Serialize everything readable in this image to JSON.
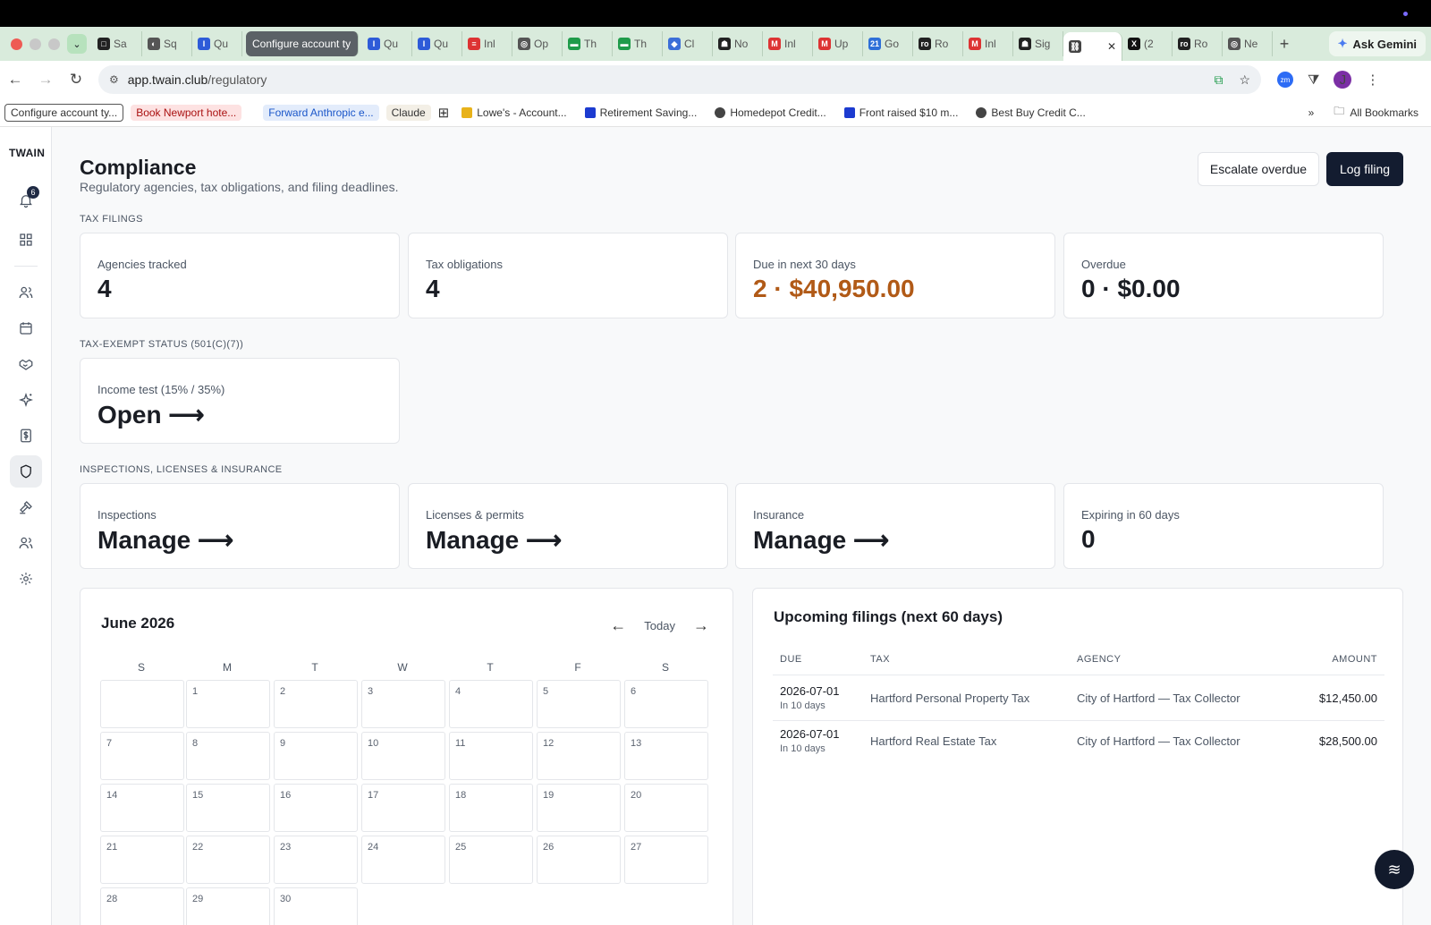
{
  "browser": {
    "tabs": [
      {
        "label": "Sa",
        "fav": "□",
        "color": "#222"
      },
      {
        "label": "Sq",
        "fav": "◐",
        "color": "#555"
      },
      {
        "label": "Qu",
        "fav": "I",
        "color": "#2e5bd8"
      },
      {
        "label": "Configure account ty",
        "highlight": true
      },
      {
        "label": "Qu",
        "fav": "I",
        "color": "#2e5bd8"
      },
      {
        "label": "Qu",
        "fav": "I",
        "color": "#2e5bd8"
      },
      {
        "label": "Inl",
        "fav": "≡",
        "color": "#d33"
      },
      {
        "label": "Op",
        "fav": "◎",
        "color": "#555"
      },
      {
        "label": "Th",
        "fav": "▬",
        "color": "#1f9b4a"
      },
      {
        "label": "Th",
        "fav": "▬",
        "color": "#1f9b4a"
      },
      {
        "label": "Cl",
        "fav": "◆",
        "color": "#3b6ed8"
      },
      {
        "label": "No",
        "fav": "☗",
        "color": "#222"
      },
      {
        "label": "Inl",
        "fav": "M",
        "color": "#d33"
      },
      {
        "label": "Up",
        "fav": "M",
        "color": "#d33"
      },
      {
        "label": "Go",
        "fav": "21",
        "color": "#2e6fd8"
      },
      {
        "label": "Ro",
        "fav": "ro",
        "color": "#222"
      },
      {
        "label": "Inl",
        "fav": "M",
        "color": "#d33"
      },
      {
        "label": "Sig",
        "fav": "☗",
        "color": "#222"
      },
      {
        "label": "",
        "fav": "⛓",
        "color": "#444",
        "active": true
      },
      {
        "label": "(2",
        "fav": "X",
        "color": "#111"
      },
      {
        "label": "Ro",
        "fav": "ro",
        "color": "#222"
      },
      {
        "label": "Ne",
        "fav": "◎",
        "color": "#555"
      }
    ],
    "gemini_label": "Ask Gemini",
    "url_host": "app.twain.club",
    "url_path": "/regulatory",
    "bookmarks": [
      {
        "label": "Configure account ty...",
        "style": "boxed"
      },
      {
        "label": "Book Newport hote...",
        "style": "pink"
      },
      {
        "label": "",
        "style": "sq-blue"
      },
      {
        "label": "",
        "style": "sq-dark"
      },
      {
        "label": "Forward Anthropic e...",
        "style": "blue"
      },
      {
        "label": "Claude",
        "style": "claude"
      },
      {
        "label": "",
        "style": "grid"
      },
      {
        "label": "Lowe's - Account...",
        "style": "plain"
      },
      {
        "label": "Retirement Saving...",
        "style": "plain"
      },
      {
        "label": "Homedepot Credit...",
        "style": "plain"
      },
      {
        "label": "Front raised $10 m...",
        "style": "plain"
      },
      {
        "label": "Best Buy Credit C...",
        "style": "plain"
      }
    ],
    "all_bookmarks": "All Bookmarks"
  },
  "app": {
    "logo": "TWAIN",
    "notification_count": "6",
    "title": "Compliance",
    "subtitle": "Regulatory agencies, tax obligations, and filing deadlines.",
    "escalate_label": "Escalate overdue",
    "log_filing_label": "Log filing",
    "tax_filings": {
      "label": "TAX FILINGS",
      "cards": [
        {
          "label": "Agencies tracked",
          "value": "4"
        },
        {
          "label": "Tax obligations",
          "value": "4"
        },
        {
          "label": "Due in next 30 days",
          "value": "2 · $40,950.00",
          "accent": "#b15a17"
        },
        {
          "label": "Overdue",
          "value": "0 · $0.00"
        }
      ]
    },
    "tax_exempt": {
      "label": "TAX-EXEMPT STATUS (501(C)(7))",
      "card": {
        "label": "Income test (15% / 35%)",
        "value": "Open ⟶"
      }
    },
    "inspections": {
      "label": "INSPECTIONS, LICENSES & INSURANCE",
      "cards": [
        {
          "label": "Inspections",
          "value": "Manage ⟶"
        },
        {
          "label": "Licenses & permits",
          "value": "Manage ⟶"
        },
        {
          "label": "Insurance",
          "value": "Manage ⟶"
        },
        {
          "label": "Expiring in 60 days",
          "value": "0"
        }
      ]
    },
    "calendar": {
      "month": "June 2026",
      "prev": "←",
      "today": "Today",
      "next": "→",
      "weekdays": [
        "S",
        "M",
        "T",
        "W",
        "T",
        "F",
        "S"
      ],
      "days": [
        "",
        "1",
        "2",
        "3",
        "4",
        "5",
        "6",
        "7",
        "8",
        "9",
        "10",
        "11",
        "12",
        "13",
        "14",
        "15",
        "16",
        "17",
        "18",
        "19",
        "20",
        "21",
        "22",
        "23",
        "24",
        "25",
        "26",
        "27",
        "28",
        "29",
        "30"
      ]
    },
    "upcoming": {
      "title": "Upcoming filings (next 60 days)",
      "headers": {
        "due": "DUE",
        "tax": "TAX",
        "agency": "AGENCY",
        "amount": "AMOUNT"
      },
      "rows": [
        {
          "due": "2026-07-01",
          "due_sub": "In 10 days",
          "tax": "Hartford Personal Property Tax",
          "agency": "City of Hartford — Tax Collector",
          "amount": "$12,450.00"
        },
        {
          "due": "2026-07-01",
          "due_sub": "In 10 days",
          "tax": "Hartford Real Estate Tax",
          "agency": "City of Hartford — Tax Collector",
          "amount": "$28,500.00"
        }
      ]
    }
  }
}
